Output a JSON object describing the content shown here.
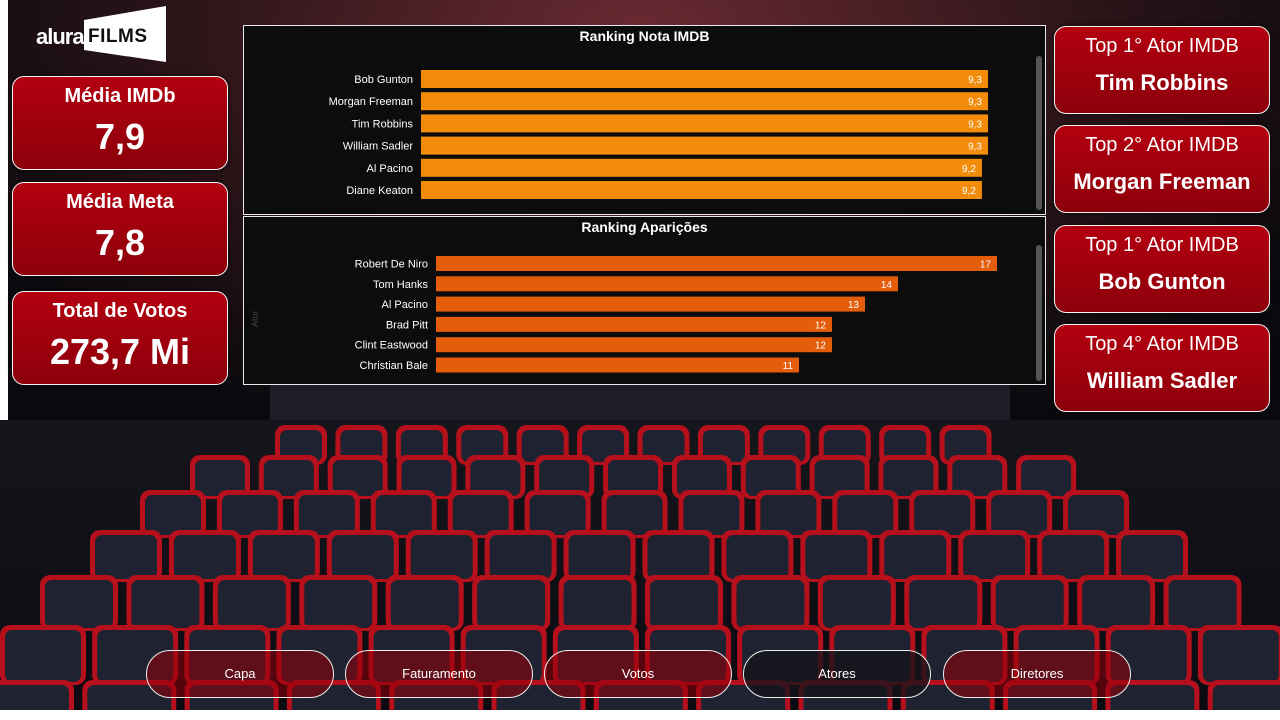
{
  "logo": {
    "brand": "alura",
    "product": "FILMS"
  },
  "kpis_left": [
    {
      "title": "Média IMDb",
      "value": "7,9"
    },
    {
      "title": "Média Meta",
      "value": "7,8"
    },
    {
      "title": "Total de Votos",
      "value": "273,7 Mi"
    }
  ],
  "kpis_right": [
    {
      "title": "Top 1° Ator IMDB",
      "value": "Tim Robbins"
    },
    {
      "title": "Top 2° Ator IMDB",
      "value": "Morgan Freeman"
    },
    {
      "title": "Top 1° Ator IMDB",
      "value": "Bob Gunton"
    },
    {
      "title": "Top 4° Ator IMDB",
      "value": "William Sadler"
    }
  ],
  "nav": [
    {
      "label": "Capa",
      "active": false
    },
    {
      "label": "Faturamento",
      "active": false
    },
    {
      "label": "Votos",
      "active": false
    },
    {
      "label": "Atores",
      "active": true
    },
    {
      "label": "Diretores",
      "active": false
    }
  ],
  "colors": {
    "card": "#a5000d",
    "bar_rating": "#f28c0a",
    "bar_appear": "#e35d0b"
  },
  "chart_data": [
    {
      "type": "bar",
      "orientation": "horizontal",
      "title": "Ranking Nota IMDB",
      "categories": [
        "Bob Gunton",
        "Morgan Freeman",
        "Tim Robbins",
        "William Sadler",
        "Al Pacino",
        "Diane Keaton"
      ],
      "values": [
        9.3,
        9.3,
        9.3,
        9.3,
        9.2,
        9.2
      ],
      "labels": [
        "9,3",
        "9,3",
        "9,3",
        "9,3",
        "9,2",
        "9,2"
      ],
      "xlim": [
        0,
        9.3
      ]
    },
    {
      "type": "bar",
      "orientation": "horizontal",
      "title": "Ranking Aparições",
      "ylabel": "Ator",
      "categories": [
        "Robert De Niro",
        "Tom Hanks",
        "Al Pacino",
        "Brad Pitt",
        "Clint Eastwood",
        "Christian Bale"
      ],
      "values": [
        17,
        14,
        13,
        12,
        12,
        11
      ],
      "labels": [
        "17",
        "14",
        "13",
        "12",
        "12",
        "11"
      ],
      "xlim": [
        0,
        17
      ]
    }
  ]
}
